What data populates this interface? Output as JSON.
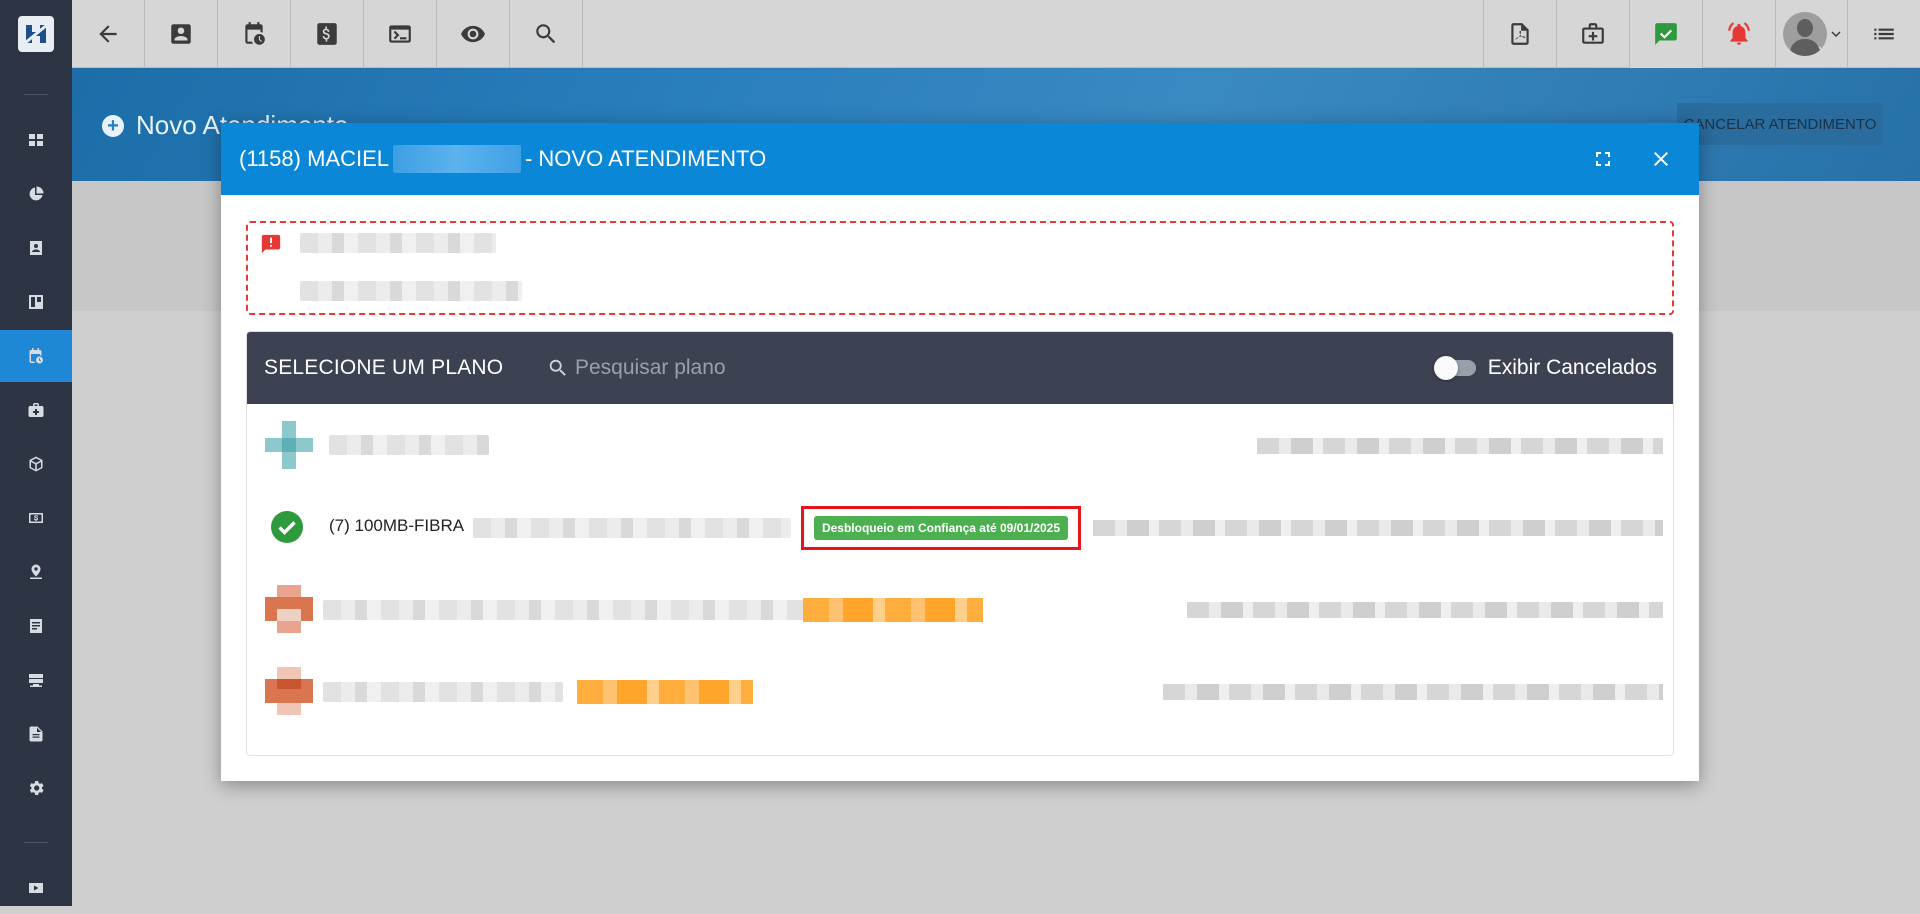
{
  "page": {
    "title": "Novo Atendimento",
    "cancel_label": "CANCELAR ATENDIMENTO"
  },
  "topbar": {
    "left_icons": [
      "back-arrow-icon",
      "contact-card-icon",
      "schedule-icon",
      "dollar-icon",
      "terminal-icon",
      "eye-icon",
      "search-icon"
    ],
    "right_icons": [
      "pdf-icon",
      "briefcase-icon",
      "task-check-icon",
      "alarm-bell-icon",
      "avatar",
      "menu-list-icon"
    ]
  },
  "sidebar": {
    "items": [
      "dashboard-icon",
      "pie-chart-icon",
      "contact-icon",
      "board-icon",
      "schedule-icon",
      "briefcase-icon",
      "package-icon",
      "money-icon",
      "map-pin-icon",
      "list-icon",
      "server-icon",
      "document-icon",
      "settings-icon",
      "video-icon"
    ],
    "active_index": 4
  },
  "modal": {
    "title_prefix": "(1158) MACIEL",
    "title_suffix": "- NOVO ATENDIMENTO",
    "accent_color": "#0a87d6"
  },
  "plans": {
    "header": "SELECIONE UM PLANO",
    "search_placeholder": "Pesquisar plano",
    "toggle_label": "Exibir Cancelados",
    "toggle_on": false,
    "rows": [
      {
        "name": "",
        "status": "unknown",
        "badge": ""
      },
      {
        "name": "(7) 100MB-FIBRA",
        "status": "active",
        "badge": "Desbloqueio em Confiança até 09/01/2025",
        "badge_color": "#4caf50"
      },
      {
        "name": "",
        "status": "warning",
        "badge": ""
      },
      {
        "name": "",
        "status": "warning",
        "badge": ""
      }
    ]
  }
}
